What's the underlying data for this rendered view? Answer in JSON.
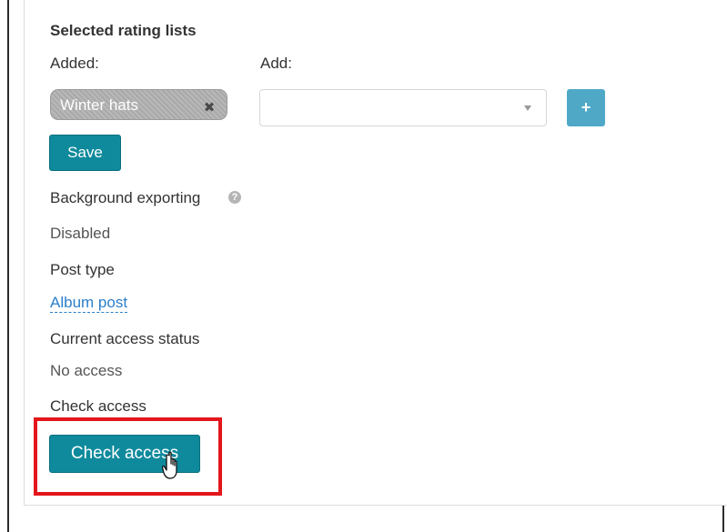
{
  "section": {
    "title": "Selected rating lists"
  },
  "lists": {
    "added_label": "Added:",
    "add_label": "Add:",
    "tags": [
      {
        "label": "Winter hats"
      }
    ],
    "select_value": "",
    "add_button": "+"
  },
  "save_label": "Save",
  "background_exporting": {
    "label": "Background exporting",
    "value": "Disabled"
  },
  "post_type": {
    "label": "Post type",
    "value": "Album post"
  },
  "access_status": {
    "label": "Current access status",
    "value": "No access"
  },
  "check_access": {
    "label": "Check access",
    "button": "Check access"
  },
  "colors": {
    "accent": "#0f8a9c",
    "link": "#2a7fc9",
    "highlight": "#e3161b",
    "tag": "#b0b0b0"
  }
}
